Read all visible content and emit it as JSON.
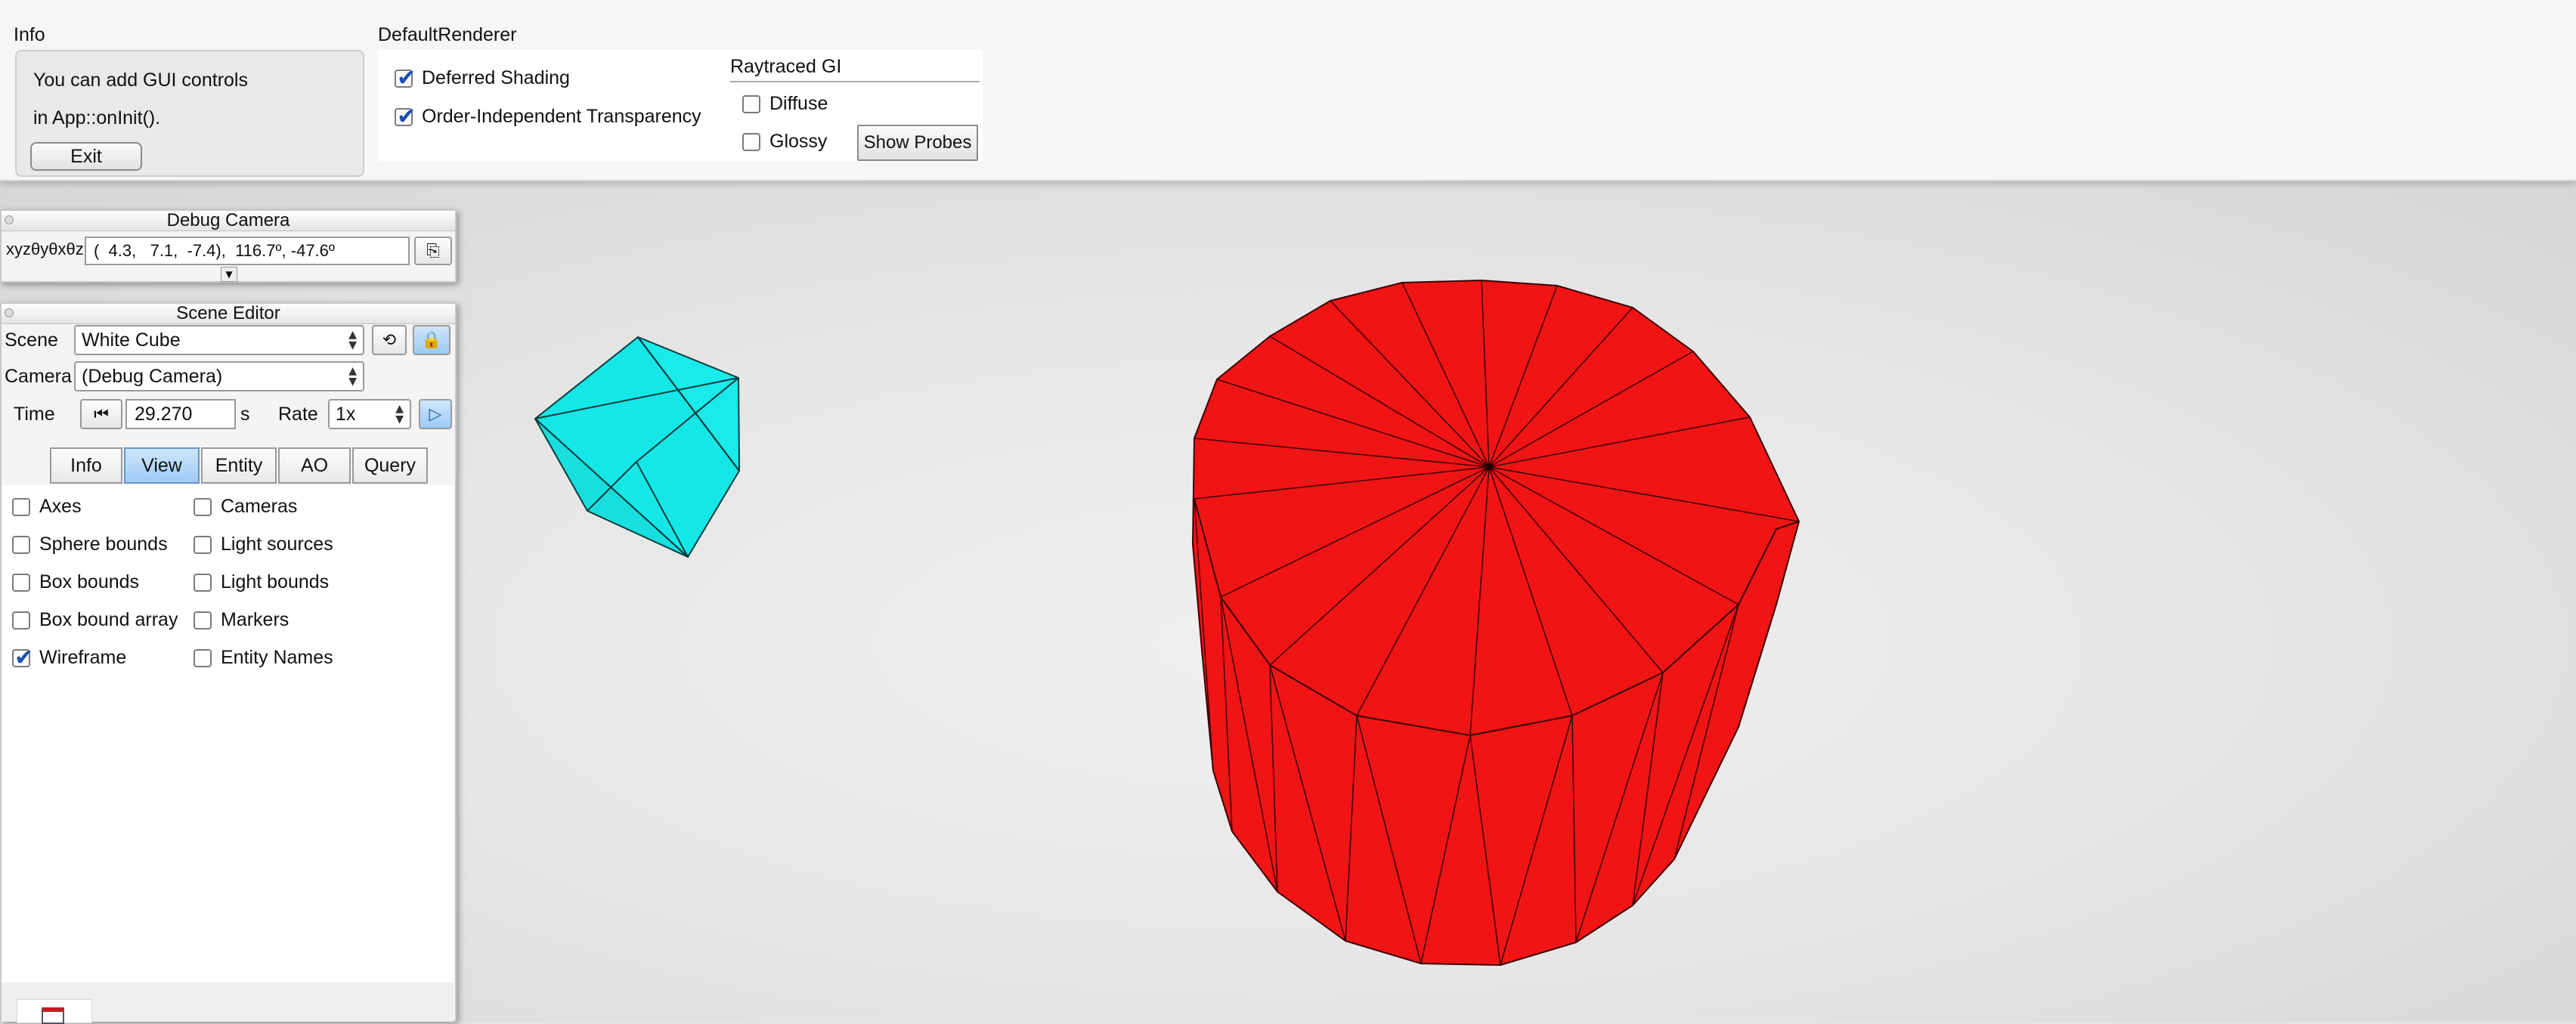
{
  "info": {
    "title": "Info",
    "line1": "You can add GUI controls",
    "line2": "in App::onInit().",
    "exit_label": "Exit"
  },
  "renderer": {
    "title": "DefaultRenderer",
    "deferred_shading": {
      "label": "Deferred Shading",
      "checked": true
    },
    "oit": {
      "label": "Order-Independent Transparency",
      "checked": true
    },
    "gi_title": "Raytraced GI",
    "diffuse": {
      "label": "Diffuse",
      "checked": false
    },
    "glossy": {
      "label": "Glossy",
      "checked": false
    },
    "show_probes_label": "Show Probes"
  },
  "debug_camera": {
    "title": "Debug Camera",
    "coord_label": "xyzθyθxθz",
    "coord_value": "(  4.3,   7.1,  -7.4),  116.7º, -47.6º",
    "icons": [
      "copy-icon",
      "expand-arrow-icon"
    ]
  },
  "scene_editor": {
    "title": "Scene Editor",
    "scene_label": "Scene",
    "scene_value": "White Cube",
    "camera_label": "Camera",
    "camera_value": "(Debug Camera)",
    "time_label": "Time",
    "time_value": "29.270",
    "time_unit": "s",
    "rate_label": "Rate",
    "rate_value": "1x",
    "tabs": [
      {
        "label": "Info",
        "active": false
      },
      {
        "label": "View",
        "active": true
      },
      {
        "label": "Entity",
        "active": false
      },
      {
        "label": "AO",
        "active": false
      },
      {
        "label": "Query",
        "active": false
      }
    ],
    "view_options_left": [
      {
        "label": "Axes",
        "checked": false
      },
      {
        "label": "Sphere bounds",
        "checked": false
      },
      {
        "label": "Box bounds",
        "checked": false
      },
      {
        "label": "Box bound array",
        "checked": false
      },
      {
        "label": "Wireframe",
        "checked": true
      }
    ],
    "view_options_right": [
      {
        "label": "Cameras",
        "checked": false
      },
      {
        "label": "Light sources",
        "checked": false
      },
      {
        "label": "Light bounds",
        "checked": false
      },
      {
        "label": "Markers",
        "checked": false
      },
      {
        "label": "Entity Names",
        "checked": false
      }
    ]
  },
  "colors": {
    "cube": "#15e6e6",
    "cylinder": "#f01414",
    "tab_active": "#9ccbf5",
    "check_mark": "#1c4fb0"
  }
}
